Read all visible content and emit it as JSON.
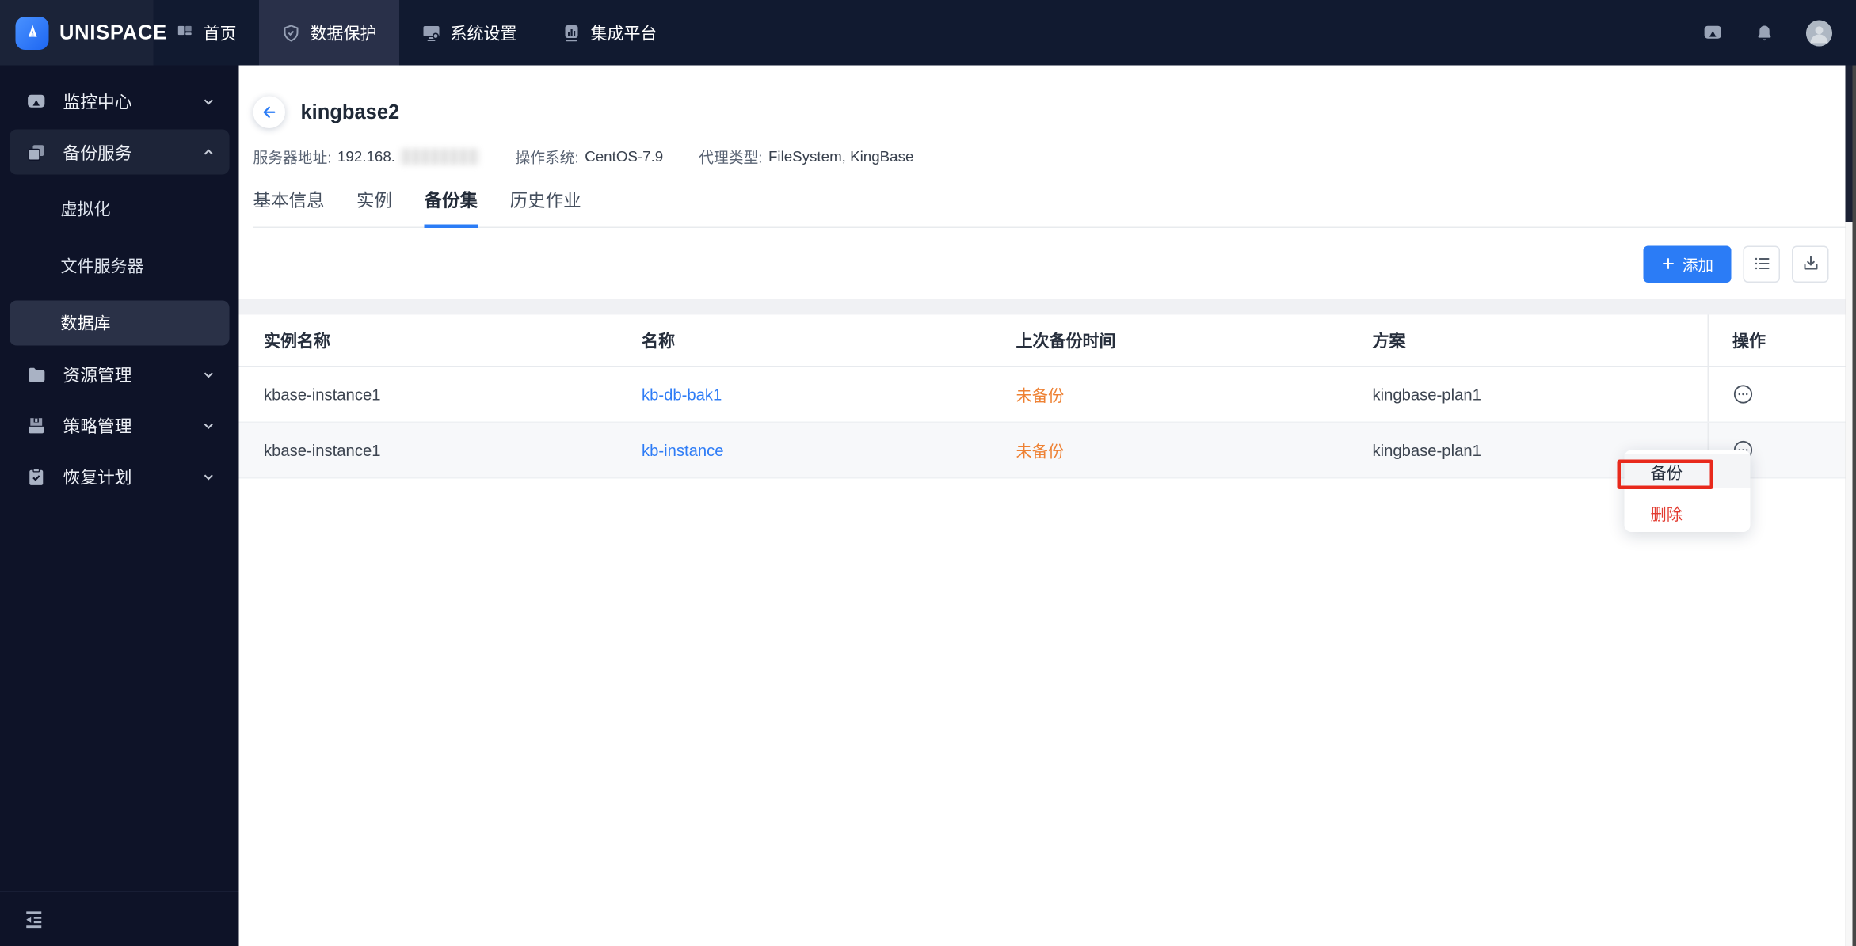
{
  "colors": {
    "primary": "#2b7cf6",
    "link": "#2e7cf6",
    "warning": "#ee8133",
    "danger": "#e23b30",
    "annotation_red": "#e8291c",
    "topbar_bg": "#111a30",
    "sidebar_bg": "#0e1328"
  },
  "topbar": {
    "brand": "UNISPACE",
    "nav": [
      {
        "label": "首页"
      },
      {
        "label": "数据保护"
      },
      {
        "label": "系统设置"
      },
      {
        "label": "集成平台"
      }
    ]
  },
  "sidebar": {
    "items": [
      {
        "label": "监控中心"
      },
      {
        "label": "备份服务"
      },
      {
        "label": "虚拟化"
      },
      {
        "label": "文件服务器"
      },
      {
        "label": "数据库"
      },
      {
        "label": "资源管理"
      },
      {
        "label": "策略管理"
      },
      {
        "label": "恢复计划"
      }
    ]
  },
  "header": {
    "title": "kingbase2",
    "server_label": "服务器地址:",
    "server_value": "192.168.",
    "os_label": "操作系统:",
    "os_value": "CentOS-7.9",
    "agent_label": "代理类型:",
    "agent_value": "FileSystem, KingBase"
  },
  "tabs": [
    {
      "label": "基本信息"
    },
    {
      "label": "实例"
    },
    {
      "label": "备份集"
    },
    {
      "label": "历史作业"
    }
  ],
  "toolbar": {
    "add_label": "添加"
  },
  "table": {
    "headers": [
      "实例名称",
      "名称",
      "上次备份时间",
      "方案",
      "操作"
    ],
    "rows": [
      {
        "instance": "kbase-instance1",
        "name": "kb-db-bak1",
        "last_backup": "未备份",
        "plan": "kingbase-plan1"
      },
      {
        "instance": "kbase-instance1",
        "name": "kb-instance",
        "last_backup": "未备份",
        "plan": "kingbase-plan1"
      }
    ]
  },
  "row_menu": {
    "backup": "备份",
    "delete": "删除"
  }
}
